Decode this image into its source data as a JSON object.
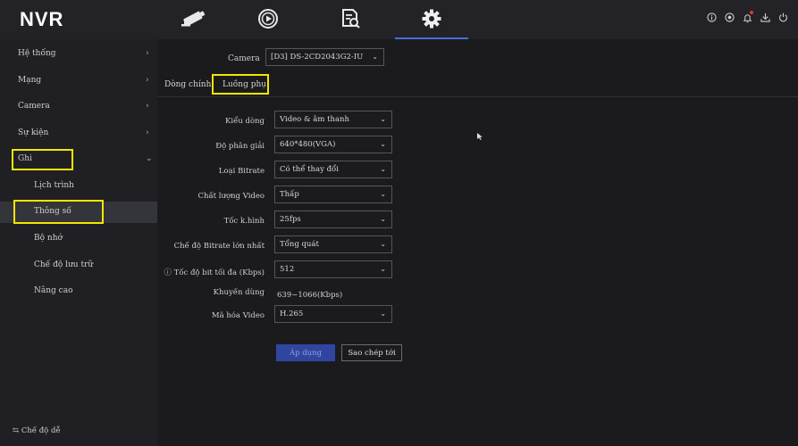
{
  "app": {
    "logo": "NVR"
  },
  "topnav": {
    "items": [
      {
        "name": "live-view",
        "icon": "camera-icon"
      },
      {
        "name": "playback",
        "icon": "playback-icon"
      },
      {
        "name": "search",
        "icon": "file-search-icon"
      },
      {
        "name": "config",
        "icon": "gear-icon",
        "active": true
      }
    ],
    "right_icons": [
      "info-icon",
      "record-icon",
      "bell-icon",
      "download-icon",
      "power-icon"
    ],
    "accent_color": "#4670d8"
  },
  "sidebar": {
    "items": [
      {
        "label": "Hệ thống",
        "chevron": "›"
      },
      {
        "label": "Mạng",
        "chevron": "›"
      },
      {
        "label": "Camera",
        "chevron": "›"
      },
      {
        "label": "Sự kiện",
        "chevron": "›"
      },
      {
        "label": "Ghi",
        "chevron": "⌄"
      }
    ],
    "sub_items": [
      {
        "label": "Lịch trình"
      },
      {
        "label": "Thông số",
        "active": true
      },
      {
        "label": "Bộ nhớ"
      },
      {
        "label": "Chế độ lưu trữ"
      },
      {
        "label": "Nâng cao"
      }
    ],
    "bottom": "⇆ Chế độ dễ"
  },
  "main": {
    "camera_label": "Camera",
    "camera_value": "[D3] DS-2CD2043G2-IU",
    "tabs": [
      "Dòng chính",
      "Luồng phụ"
    ],
    "active_tab": "Luồng phụ",
    "fields": [
      {
        "label": "Kiểu dòng",
        "value": "Video & âm thanh"
      },
      {
        "label": "Độ phân giải",
        "value": "640*480(VGA)"
      },
      {
        "label": "Loại Bitrate",
        "value": "Có thể thay đổi"
      },
      {
        "label": "Chất lượng Video",
        "value": "Thấp"
      },
      {
        "label": "Tốc k.hình",
        "value": "25fps"
      },
      {
        "label": "Chế độ Bitrate lớn nhất",
        "value": "Tổng quát"
      },
      {
        "label": "ⓘ Tốc độ bit tối đa (Kbps)",
        "value": "512"
      }
    ],
    "recommended_label": "Khuyến dùng",
    "recommended_value": "639~1066(Kbps)",
    "codec_label": "Mã hóa Video",
    "codec_value": "H.265",
    "apply_label": "Áp dụng",
    "copy_label": "Sao chép tới"
  },
  "highlight_color": "#f2e600"
}
